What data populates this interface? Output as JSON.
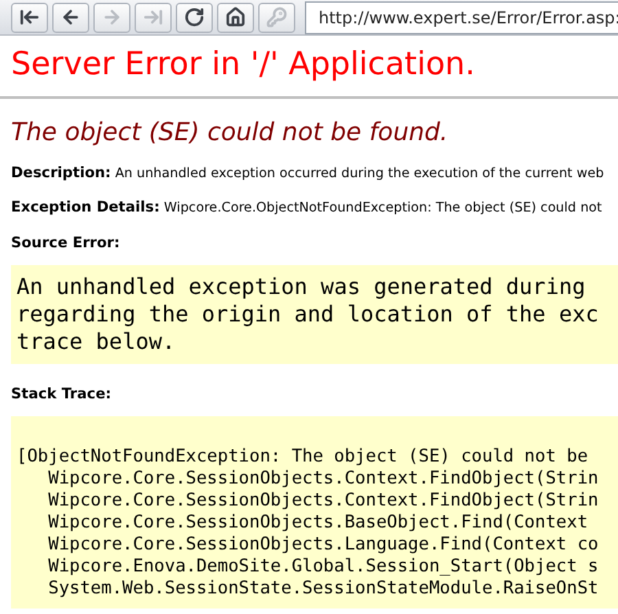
{
  "toolbar": {
    "buttons": [
      {
        "kind": "first",
        "disabled": false
      },
      {
        "kind": "back",
        "disabled": false
      },
      {
        "kind": "forward",
        "disabled": true
      },
      {
        "kind": "last",
        "disabled": true
      },
      {
        "kind": "reload",
        "disabled": false
      },
      {
        "kind": "home",
        "disabled": false
      },
      {
        "kind": "key",
        "disabled": true
      }
    ],
    "address": "http://www.expert.se/Error/Error.asp:"
  },
  "page": {
    "title": "Server Error in '/' Application.",
    "subtitle": "The object (SE) could not be found.",
    "description": {
      "label": "Description:",
      "text": "An unhandled exception occurred during the execution of the current web"
    },
    "exception_details": {
      "label": "Exception Details:",
      "text": "Wipcore.Core.ObjectNotFoundException: The object (SE) could not"
    },
    "source_error": {
      "label": "Source Error:",
      "lines": [
        "An unhandled exception was generated during",
        "regarding the origin and location of the exc",
        "trace below."
      ]
    },
    "stack_trace": {
      "label": "Stack Trace:",
      "lines": [
        "[ObjectNotFoundException: The object (SE) could not be",
        "   Wipcore.Core.SessionObjects.Context.FindObject(Strin",
        "   Wipcore.Core.SessionObjects.Context.FindObject(Strin",
        "   Wipcore.Core.SessionObjects.BaseObject.Find(Context",
        "   Wipcore.Core.SessionObjects.Language.Find(Context co",
        "   Wipcore.Enova.DemoSite.Global.Session_Start(Object s",
        "   System.Web.SessionState.SessionStateModule.RaiseOnSt"
      ]
    }
  }
}
